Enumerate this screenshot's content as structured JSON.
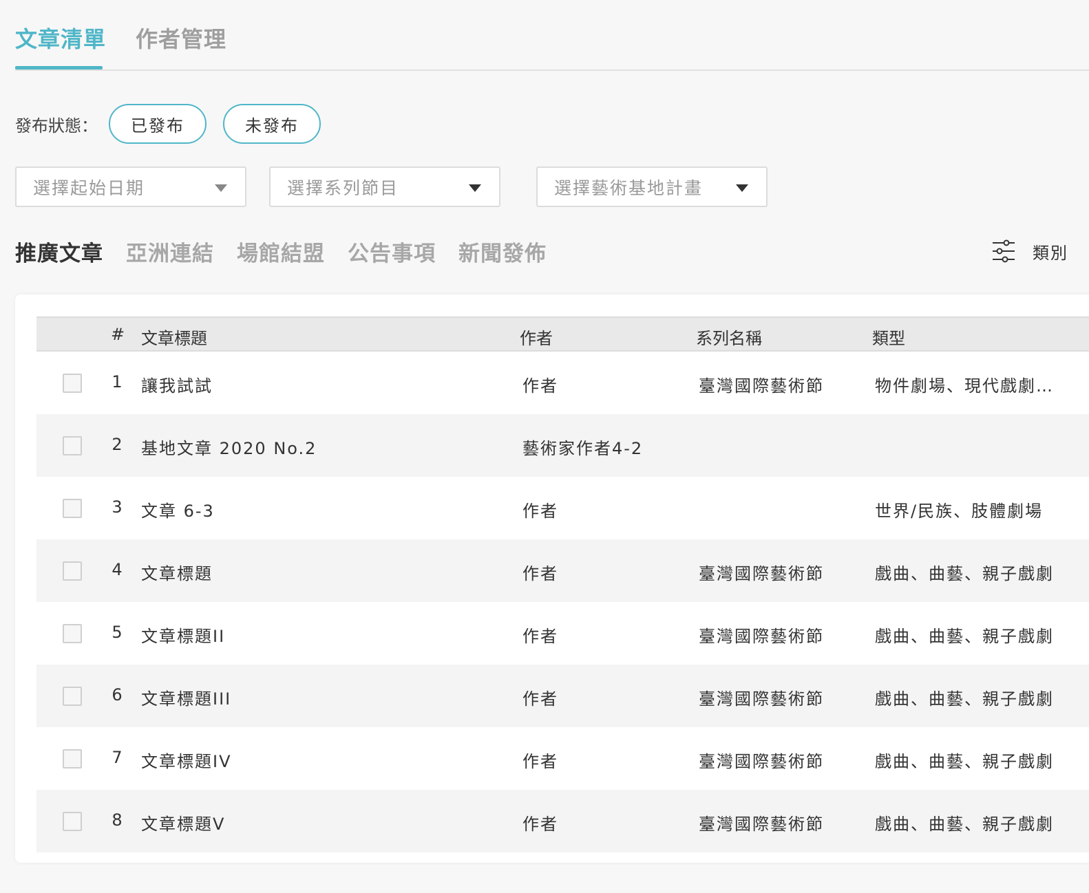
{
  "main_tabs": [
    {
      "label": "文章清單",
      "active": true
    },
    {
      "label": "作者管理",
      "active": false
    }
  ],
  "status_filter": {
    "label": "發布狀態：",
    "options": [
      "已發布",
      "未發布"
    ]
  },
  "dropdowns": [
    {
      "placeholder": "選擇起始日期"
    },
    {
      "placeholder": "選擇系列節目"
    },
    {
      "placeholder": "選擇藝術基地計畫"
    }
  ],
  "category_tabs": [
    {
      "label": "推廣文章",
      "active": true
    },
    {
      "label": "亞洲連結",
      "active": false
    },
    {
      "label": "場館結盟",
      "active": false
    },
    {
      "label": "公告事項",
      "active": false
    },
    {
      "label": "新聞發佈",
      "active": false
    }
  ],
  "category_filter": {
    "label": "類別",
    "icon": "sliders-icon"
  },
  "table": {
    "headers": {
      "num": "#",
      "title": "文章標題",
      "author": "作者",
      "series": "系列名稱",
      "type": "類型"
    },
    "rows": [
      {
        "num": "1",
        "title": "讓我試試",
        "author": "作者",
        "series": "臺灣國際藝術節",
        "type": "物件劇場、現代戲劇…"
      },
      {
        "num": "2",
        "title": "基地文章 2020 No.2",
        "author": "藝術家作者4-2",
        "series": "",
        "type": ""
      },
      {
        "num": "3",
        "title": "文章 6-3",
        "author": "作者",
        "series": "",
        "type": "世界/民族、肢體劇場"
      },
      {
        "num": "4",
        "title": "文章標題",
        "author": "作者",
        "series": "臺灣國際藝術節",
        "type": "戲曲、曲藝、親子戲劇"
      },
      {
        "num": "5",
        "title": "文章標題II",
        "author": "作者",
        "series": "臺灣國際藝術節",
        "type": "戲曲、曲藝、親子戲劇"
      },
      {
        "num": "6",
        "title": "文章標題III",
        "author": "作者",
        "series": "臺灣國際藝術節",
        "type": "戲曲、曲藝、親子戲劇"
      },
      {
        "num": "7",
        "title": "文章標題IV",
        "author": "作者",
        "series": "臺灣國際藝術節",
        "type": "戲曲、曲藝、親子戲劇"
      },
      {
        "num": "8",
        "title": "文章標題V",
        "author": "作者",
        "series": "臺灣國際藝術節",
        "type": "戲曲、曲藝、親子戲劇"
      }
    ]
  },
  "colors": {
    "accent": "#4fb6c8",
    "text": "#333333",
    "muted": "#9e9e9e"
  }
}
